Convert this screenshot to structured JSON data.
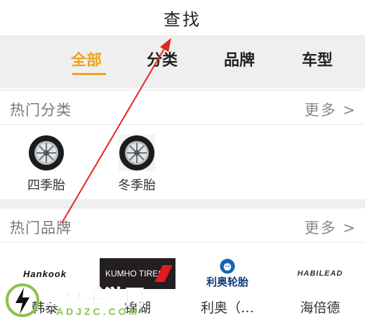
{
  "header": {
    "title": "查找"
  },
  "tabs": [
    {
      "label": "全部",
      "active": true
    },
    {
      "label": "分类",
      "active": false
    },
    {
      "label": "品牌",
      "active": false
    },
    {
      "label": "车型",
      "active": false
    }
  ],
  "hot_categories": {
    "title": "热门分类",
    "more": "更多 >",
    "items": [
      {
        "name": "四季胎",
        "icon": "tire-icon"
      },
      {
        "name": "冬季胎",
        "icon": "tire-icon"
      }
    ]
  },
  "hot_brands": {
    "title": "热门品牌",
    "more": "更多 >",
    "items": [
      {
        "name": "韩泰",
        "logo_text": "Hankook"
      },
      {
        "name": "锦湖",
        "logo_text": "KUMHO TIRES"
      },
      {
        "name": "利奥（…",
        "logo_text": "利奥轮胎"
      },
      {
        "name": "海倍德",
        "logo_text": "HABILEAD"
      }
    ]
  },
  "watermark": {
    "text": "爱豆手游网",
    "sub": "ADJZC.COM"
  },
  "colors": {
    "accent": "#f0a31c",
    "annotation_arrow": "#e0281e"
  }
}
